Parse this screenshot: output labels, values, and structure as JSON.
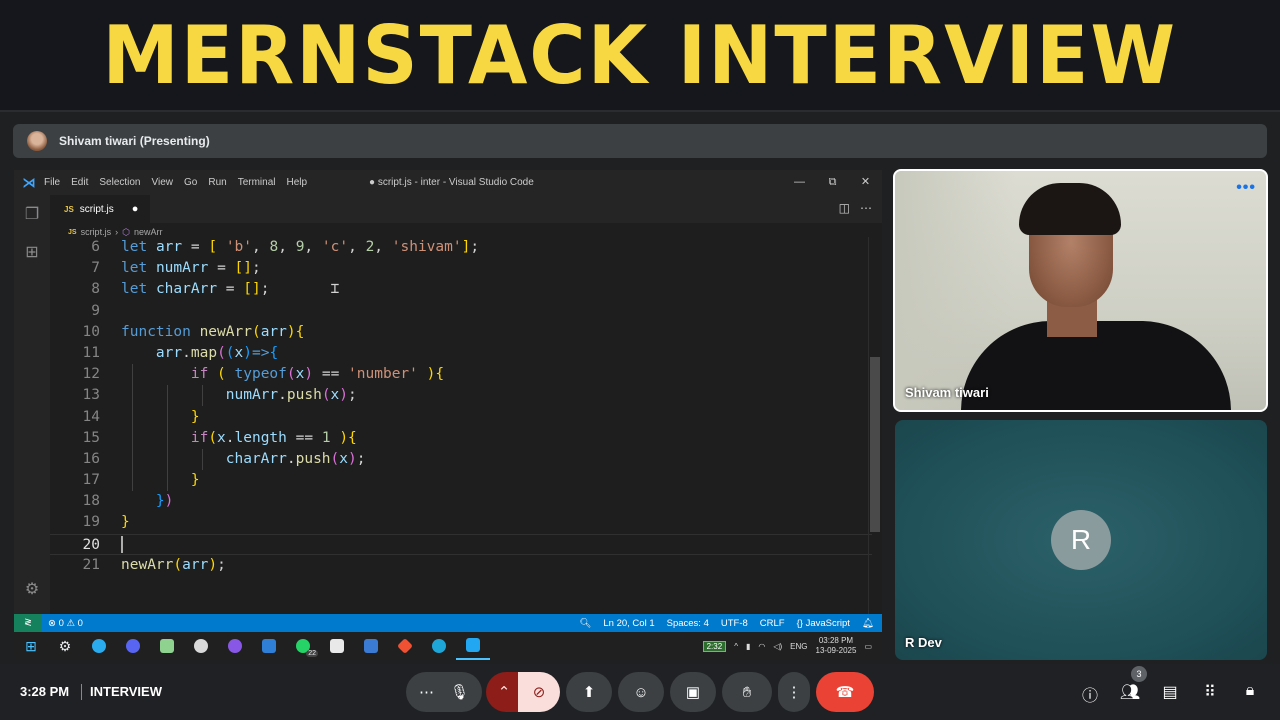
{
  "banner": {
    "title": "MERNSTACK INTERVIEW"
  },
  "presenting": {
    "label": "Shivam tiwari (Presenting)"
  },
  "vscode": {
    "menu": [
      "File",
      "Edit",
      "Selection",
      "View",
      "Go",
      "Run",
      "Terminal",
      "Help"
    ],
    "window_title": "● script.js - inter - Visual Studio Code",
    "tab": {
      "lang_badge": "JS",
      "label": "script.js",
      "modified_dot": "●"
    },
    "breadcrumb": {
      "file": "script.js",
      "symbol": "newArr"
    },
    "line_numbers": [
      "6",
      "7",
      "8",
      "9",
      "10",
      "11",
      "12",
      "13",
      "14",
      "15",
      "16",
      "17",
      "18",
      "19",
      "20",
      "21"
    ],
    "active_line": "20",
    "status": {
      "problems": "⊗ 0 ⚠ 0",
      "position": "Ln 20, Col 1",
      "spaces": "Spaces: 4",
      "encoding": "UTF-8",
      "eol": "CRLF",
      "language": "{} JavaScript"
    }
  },
  "taskbar": {
    "whatsapp_badge": "22",
    "battery": "2:32",
    "lang": "ENG",
    "time": "03:28 PM",
    "date": "13-09-2025"
  },
  "participants": {
    "presenter_name": "Shivam tiwari",
    "other_name": "R Dev",
    "other_initial": "R"
  },
  "meet": {
    "time": "3:28 PM",
    "title": "INTERVIEW",
    "people_count": "3"
  },
  "colors": {
    "banner_text": "#f7d842",
    "status_bar": "#007acc",
    "end_call": "#ea4335"
  }
}
